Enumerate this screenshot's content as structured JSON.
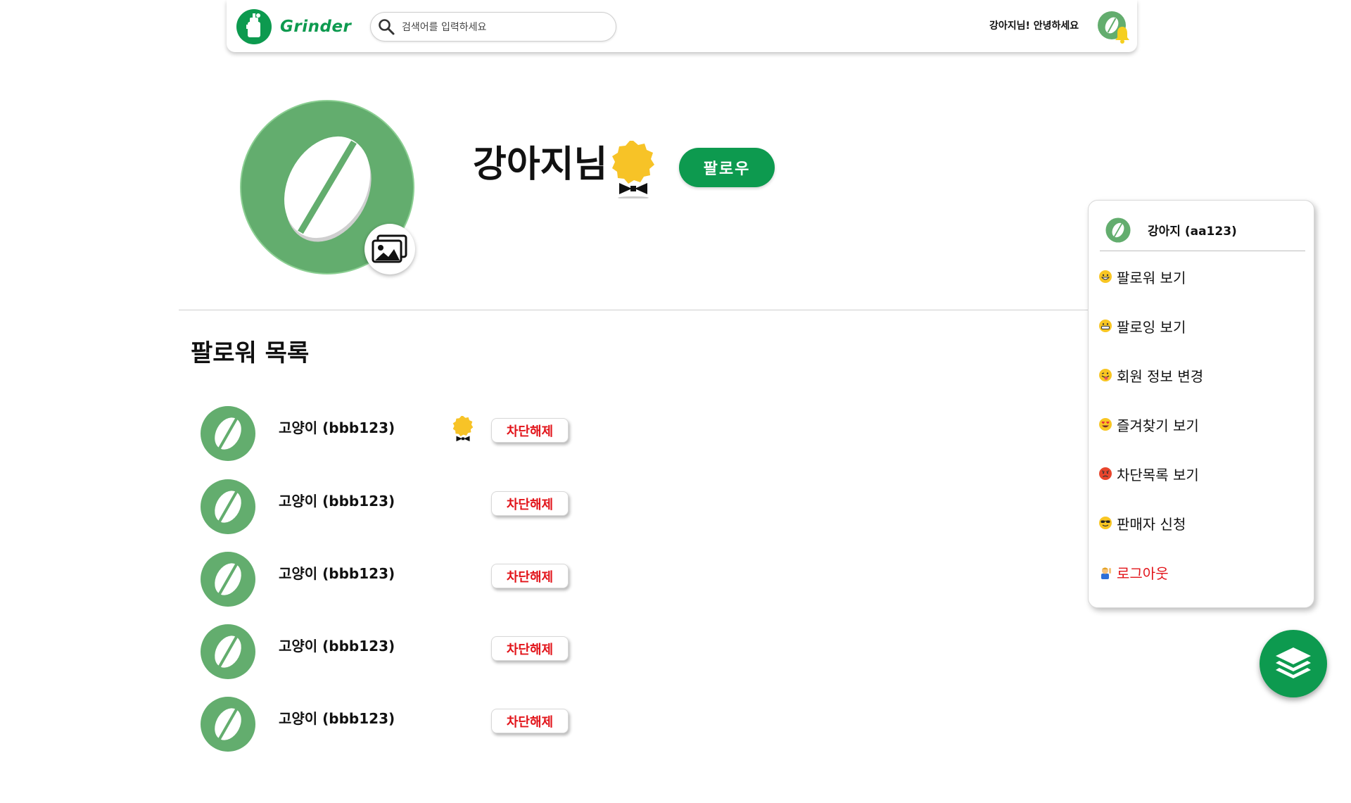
{
  "header": {
    "brand": "Grinder",
    "search_placeholder": "검색어를 입력하세요",
    "greeting": "강아지님! 안녕하세요"
  },
  "profile": {
    "name": "강아지님",
    "follow_label": "팔로우"
  },
  "followers": {
    "title": "팔로워 목록",
    "items": [
      {
        "name": "고양이 (bbb123)",
        "badge": true,
        "action": "차단해제"
      },
      {
        "name": "고양이 (bbb123)",
        "badge": false,
        "action": "차단해제"
      },
      {
        "name": "고양이 (bbb123)",
        "badge": false,
        "action": "차단해제"
      },
      {
        "name": "고양이 (bbb123)",
        "badge": false,
        "action": "차단해제"
      },
      {
        "name": "고양이 (bbb123)",
        "badge": false,
        "action": "차단해제"
      }
    ]
  },
  "menu": {
    "user": "강아지 (aa123)",
    "items": [
      {
        "label": "팔로워 보기",
        "icon": "grin-emoji-icon"
      },
      {
        "label": "팔로잉 보기",
        "icon": "grimace-emoji-icon"
      },
      {
        "label": "회원 정보 변경",
        "icon": "tongue-emoji-icon"
      },
      {
        "label": "즐겨찾기 보기",
        "icon": "heart-eyes-emoji-icon"
      },
      {
        "label": "차단목록 보기",
        "icon": "angry-emoji-icon"
      },
      {
        "label": "판매자 신청",
        "icon": "sunglasses-emoji-icon"
      },
      {
        "label": "로그아웃",
        "icon": "waving-person-icon"
      }
    ]
  },
  "colors": {
    "brand_green": "#0d9a4f",
    "avatar_green": "#63ad6e",
    "danger_red": "#e2141a",
    "badge_gold": "#f7c327"
  }
}
